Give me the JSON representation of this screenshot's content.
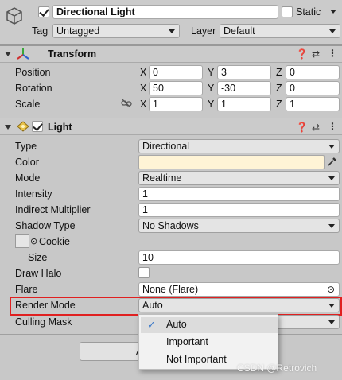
{
  "object": {
    "name": "Directional Light",
    "active": true,
    "static_label": "Static",
    "static_checked": false,
    "tag_label": "Tag",
    "tag_value": "Untagged",
    "layer_label": "Layer",
    "layer_value": "Default"
  },
  "transform": {
    "title": "Transform",
    "rows": [
      {
        "label": "Position",
        "x": "0",
        "y": "3",
        "z": "0"
      },
      {
        "label": "Rotation",
        "x": "50",
        "y": "-30",
        "z": "0"
      },
      {
        "label": "Scale",
        "x": "1",
        "y": "1",
        "z": "1"
      }
    ],
    "axis_x": "X",
    "axis_y": "Y",
    "axis_z": "Z"
  },
  "light": {
    "title": "Light",
    "enabled": true,
    "type_label": "Type",
    "type_value": "Directional",
    "color_label": "Color",
    "color_value": "#fff4d6",
    "mode_label": "Mode",
    "mode_value": "Realtime",
    "intensity_label": "Intensity",
    "intensity_value": "1",
    "indirect_label": "Indirect Multiplier",
    "indirect_value": "1",
    "shadow_label": "Shadow Type",
    "shadow_value": "No Shadows",
    "cookie_label": "Cookie",
    "size_label": "Size",
    "size_value": "10",
    "drawhalo_label": "Draw Halo",
    "flare_label": "Flare",
    "flare_value": "None (Flare)",
    "render_label": "Render Mode",
    "render_value": "Auto",
    "culling_label": "Culling Mask"
  },
  "render_mode_menu": {
    "options": [
      "Auto",
      "Important",
      "Not Important"
    ],
    "selected": "Auto"
  },
  "partial_button_label": "A",
  "watermark": "CSDN @Retrovich",
  "colors": {
    "highlight": "#e02020",
    "checkmark": "#3a78c8"
  }
}
